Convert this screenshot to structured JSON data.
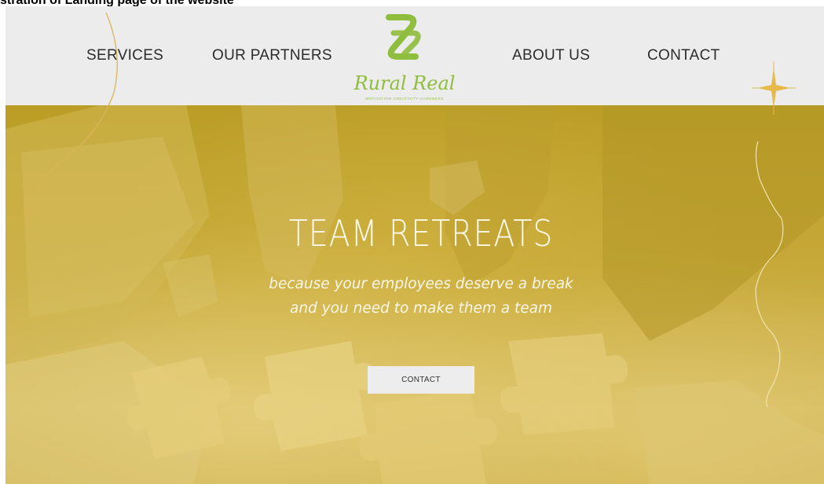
{
  "caption": "stration of Landing page of the website",
  "nav": {
    "services": "SERVICES",
    "partners": "OUR PARTNERS",
    "about": "ABOUT US",
    "contact": "CONTACT"
  },
  "logo": {
    "wordmark": "Rural Real",
    "tagline": "MOTIVATION·CREATIVITY·HARDNESS",
    "color": "#8fbd3d"
  },
  "hero": {
    "title": "TEAM RETREATS",
    "subtitle_line1": "because your employees deserve a break",
    "subtitle_line2": "and you need to make them a team",
    "cta_label": "CONTACT"
  },
  "colors": {
    "header_bg": "#ececec",
    "hero_tint": "#c7a93a",
    "accent_gold": "#d9b45a"
  }
}
